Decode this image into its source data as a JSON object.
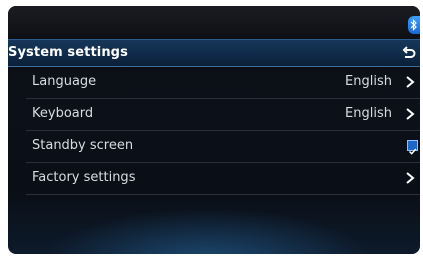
{
  "status_bar": {
    "bluetooth_icon": "bluetooth-icon"
  },
  "header": {
    "title": "System settings",
    "back_icon": "back-arrow-icon"
  },
  "settings": [
    {
      "label": "Language",
      "value": "English",
      "control": "chevron-right-icon"
    },
    {
      "label": "Keyboard",
      "value": "English",
      "control": "chevron-right-icon"
    },
    {
      "label": "Standby screen",
      "value": "",
      "control": "checkbox",
      "checked": true
    },
    {
      "label": "Factory settings",
      "value": "",
      "control": "chevron-right-icon"
    }
  ],
  "colors": {
    "accent": "#1e66c8",
    "header_bg": "#123456",
    "text": "#d9dce0"
  }
}
